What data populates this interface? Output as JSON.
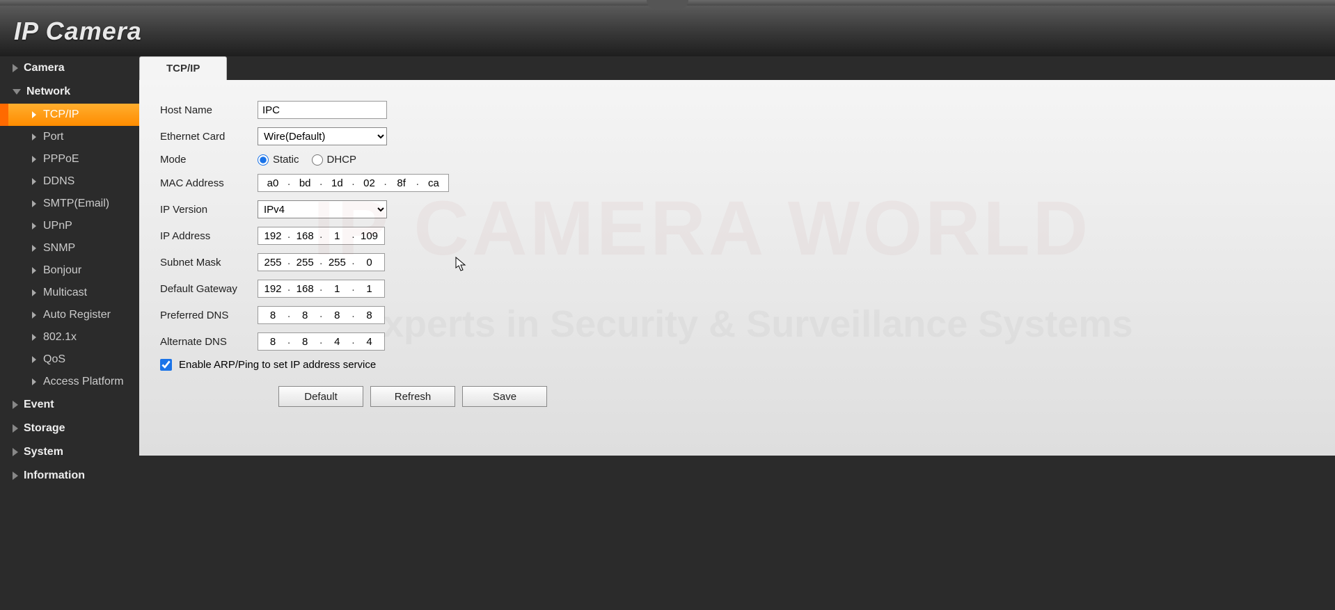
{
  "header": {
    "title": "IP Camera"
  },
  "sidebar": {
    "groups": [
      {
        "label": "Camera",
        "expanded": false,
        "items": []
      },
      {
        "label": "Network",
        "expanded": true,
        "items": [
          {
            "label": "TCP/IP",
            "active": true
          },
          {
            "label": "Port"
          },
          {
            "label": "PPPoE"
          },
          {
            "label": "DDNS"
          },
          {
            "label": "SMTP(Email)"
          },
          {
            "label": "UPnP"
          },
          {
            "label": "SNMP"
          },
          {
            "label": "Bonjour"
          },
          {
            "label": "Multicast"
          },
          {
            "label": "Auto Register"
          },
          {
            "label": "802.1x"
          },
          {
            "label": "QoS"
          },
          {
            "label": "Access Platform"
          }
        ]
      },
      {
        "label": "Event",
        "expanded": false,
        "items": []
      },
      {
        "label": "Storage",
        "expanded": false,
        "items": []
      },
      {
        "label": "System",
        "expanded": false,
        "items": []
      },
      {
        "label": "Information",
        "expanded": false,
        "items": []
      }
    ]
  },
  "tab": {
    "label": "TCP/IP"
  },
  "form": {
    "host_name": {
      "label": "Host Name",
      "value": "IPC"
    },
    "ethernet_card": {
      "label": "Ethernet Card",
      "value": "Wire(Default)"
    },
    "mode": {
      "label": "Mode",
      "static": "Static",
      "dhcp": "DHCP",
      "selected": "static"
    },
    "mac_address": {
      "label": "MAC Address",
      "octets": [
        "a0",
        "bd",
        "1d",
        "02",
        "8f",
        "ca"
      ]
    },
    "ip_version": {
      "label": "IP Version",
      "value": "IPv4"
    },
    "ip_address": {
      "label": "IP Address",
      "octets": [
        "192",
        "168",
        "1",
        "109"
      ]
    },
    "subnet_mask": {
      "label": "Subnet Mask",
      "octets": [
        "255",
        "255",
        "255",
        "0"
      ]
    },
    "gateway": {
      "label": "Default Gateway",
      "octets": [
        "192",
        "168",
        "1",
        "1"
      ]
    },
    "pref_dns": {
      "label": "Preferred DNS",
      "octets": [
        "8",
        "8",
        "8",
        "8"
      ]
    },
    "alt_dns": {
      "label": "Alternate DNS",
      "octets": [
        "8",
        "8",
        "4",
        "4"
      ]
    },
    "arp_ping": {
      "label": "Enable ARP/Ping to set IP address service",
      "checked": true
    },
    "buttons": {
      "default": "Default",
      "refresh": "Refresh",
      "save": "Save"
    }
  }
}
